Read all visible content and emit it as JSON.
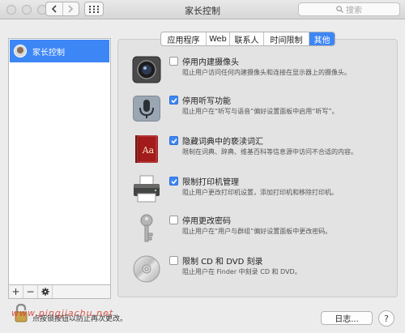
{
  "window": {
    "title": "家长控制"
  },
  "toolbar": {
    "back_icon": "chevron-left-icon",
    "forward_icon": "chevron-right-icon",
    "grid_icon": "grid-icon",
    "search_placeholder": "搜索"
  },
  "sidebar": {
    "items": [
      {
        "label": "家长控制"
      }
    ],
    "footer": {
      "add": "+",
      "remove": "−",
      "gear_icon": "gear-icon"
    }
  },
  "tabs": [
    {
      "label": "应用程序"
    },
    {
      "label": "Web"
    },
    {
      "label": "联系人"
    },
    {
      "label": "时间限制"
    },
    {
      "label": "其他",
      "active": true
    }
  ],
  "options": [
    {
      "title": "停用内建摄像头",
      "desc": "阻止用户访问任何内建摄像头和连接在显示器上的摄像头。",
      "checked": false,
      "icon": "camera-icon"
    },
    {
      "title": "停用听写功能",
      "desc": "阻止用户在“听写与语音”偏好设置面板中启用“听写”。",
      "checked": true,
      "icon": "microphone-icon"
    },
    {
      "title": "隐藏词典中的亵渎词汇",
      "desc": "限制在词典、辞典、维基百科等信息源中访问不合适的内容。",
      "checked": true,
      "icon": "dictionary-icon"
    },
    {
      "title": "限制打印机管理",
      "desc": "阻止用户更改打印机设置，添加打印机和移除打印机。",
      "checked": true,
      "icon": "printer-icon"
    },
    {
      "title": "停用更改密码",
      "desc": "阻止用户在“用户与群组”偏好设置面板中更改密码。",
      "checked": false,
      "icon": "key-icon"
    },
    {
      "title": "限制 CD 和 DVD 刻录",
      "desc": "阻止用户在 Finder 中刻录 CD 和 DVD。",
      "checked": false,
      "icon": "disc-icon"
    }
  ],
  "bottom": {
    "lock_text": "点按锁按钮以防止再次更改。",
    "watermark": "www.pingjiachu.net",
    "log_button": "日志...",
    "help_button": "?"
  },
  "colors": {
    "accent": "#3d86f6"
  }
}
